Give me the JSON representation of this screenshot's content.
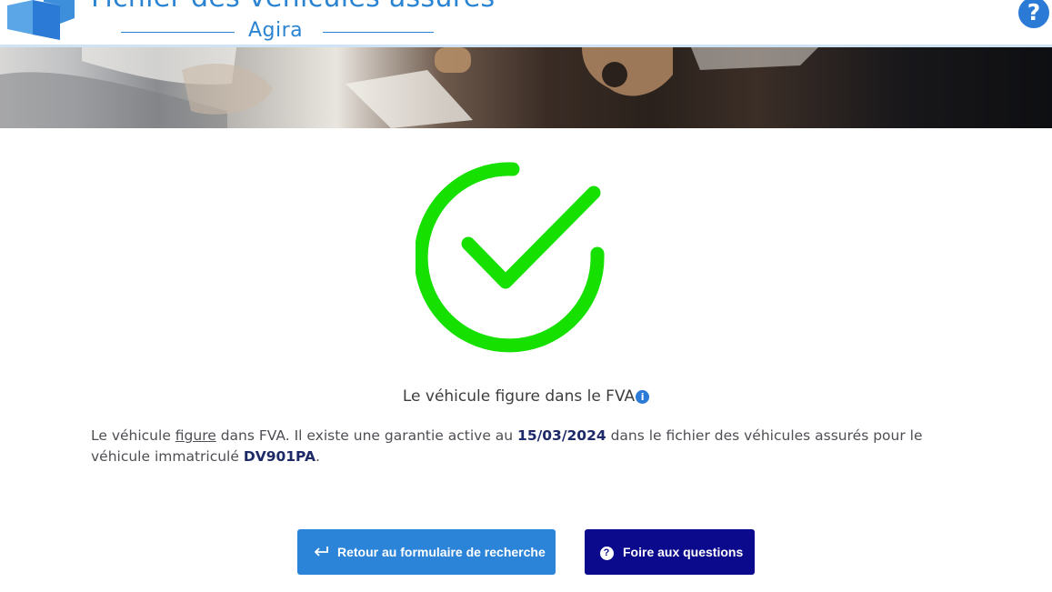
{
  "header": {
    "title": "Fichier des véhicules assurés",
    "subtitle": "Agira",
    "help_icon": "question-circle-icon",
    "help_label": "?"
  },
  "result": {
    "status_icon": "check-circle-icon",
    "title": "Le véhicule figure dans le FVA",
    "info_icon": "info-icon",
    "info_label": "i",
    "description": {
      "part1": "Le véhicule ",
      "figure_word": "figure",
      "part2": " dans FVA. Il existe une garantie active au ",
      "date": "15/03/2024",
      "part3": " dans le fichier des véhicules assurés pour le véhicule immatriculé ",
      "plate": "DV901PA",
      "part4": "."
    }
  },
  "actions": {
    "back_label": "Retour au formulaire de recherche",
    "back_icon": "return-arrow-icon",
    "faq_label": "Foire aux questions",
    "faq_icon": "question-circle-icon",
    "faq_icon_glyph": "?"
  },
  "colors": {
    "accent_blue": "#2b84d8",
    "dark_blue": "#0c0a8c",
    "success_green": "#16e000"
  }
}
